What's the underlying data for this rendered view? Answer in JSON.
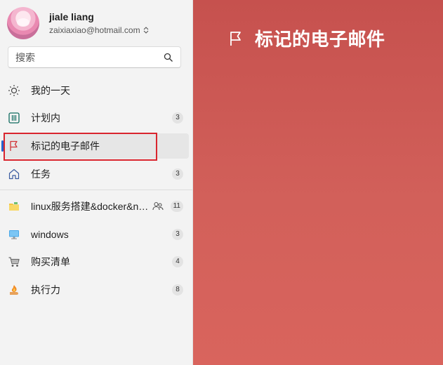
{
  "profile": {
    "name": "jiale liang",
    "email": "zaixiaxiao@hotmail.com"
  },
  "search": {
    "placeholder": "搜索"
  },
  "nav": {
    "my_day": "我的一天",
    "planned": "计划内",
    "planned_count": "3",
    "flagged": "标记的电子邮件",
    "tasks": "任务",
    "tasks_count": "3"
  },
  "lists": [
    {
      "label": "linux服务搭建&docker&nginx",
      "count": "11",
      "icon": "folder-icon",
      "shared": true
    },
    {
      "label": "windows",
      "count": "3",
      "icon": "monitor-icon"
    },
    {
      "label": "购买清单",
      "count": "4",
      "icon": "shopping-cart-icon"
    },
    {
      "label": "执行力",
      "count": "8",
      "icon": "fire-hand-icon"
    }
  ],
  "main": {
    "title": "标记的电子邮件"
  },
  "colors": {
    "accent": "#2564cf",
    "flag_red": "#d13438",
    "main_bg": "#c6514e",
    "highlight_box": "#d9252e"
  }
}
